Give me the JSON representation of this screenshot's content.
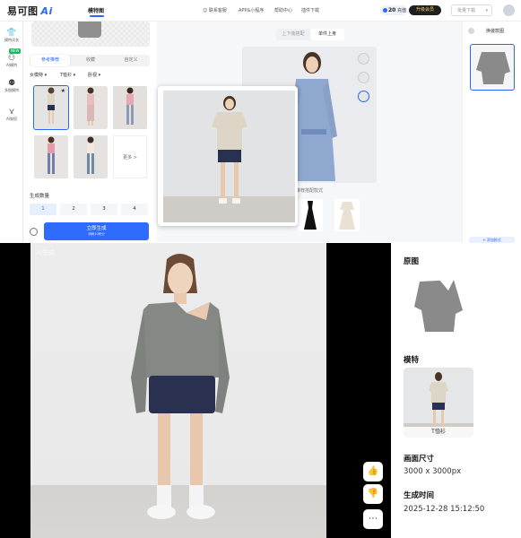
{
  "app": {
    "logo_text": "易可图",
    "logo_ai": "Ai",
    "active_nav": "模特图"
  },
  "topbar": {
    "links": [
      "联系客服",
      "APP&小程序",
      "帮助中心",
      "插件下载"
    ],
    "points": "20",
    "points_unit": "充值",
    "upgrade": "升级会员",
    "download_select": "批量下载"
  },
  "rail": {
    "items": [
      {
        "icon": "shirt-icon",
        "label": "模特试衣"
      },
      {
        "icon": "person-icon",
        "label": "AI模特"
      },
      {
        "icon": "group-icon",
        "label": "多图模特"
      },
      {
        "icon": "hanger-icon",
        "label": "AI穿搭"
      }
    ],
    "new_badge": "NEW"
  },
  "panel": {
    "tabs": [
      "参考推荐",
      "收藏",
      "自定义"
    ],
    "active_tab": 0,
    "filters": [
      "女模特",
      "T恤衫",
      "卧视"
    ],
    "more_label": "更多 >",
    "gen_count_label": "生成数量",
    "counts": [
      "1",
      "2",
      "3",
      "4"
    ],
    "selected_count": 0,
    "generate_label": "立即生成",
    "generate_sub": "消耗10积分"
  },
  "canvas": {
    "toggle": [
      "上下装搭配",
      "单件上身"
    ],
    "active_toggle": 1,
    "recommend_label": "推荐搭配款式"
  },
  "right_top": {
    "title": "换装款图",
    "bottom_btn": "+ 添加款式"
  },
  "viewer": {
    "watermark": "AI生成"
  },
  "info": {
    "original_label": "原图",
    "model_label": "模特",
    "model_caption": "T恤衫",
    "size_label": "画面尺寸",
    "size_value": "3000 x 3000px",
    "time_label": "生成时间",
    "time_value": "2025-12-28 15:12:50"
  },
  "colors": {
    "accent": "#2f6bff",
    "top_gray": "#858885",
    "shorts_navy": "#2a3150",
    "shirt_blue": "#8fa8d0",
    "tee_beige": "#ddd6c6"
  }
}
